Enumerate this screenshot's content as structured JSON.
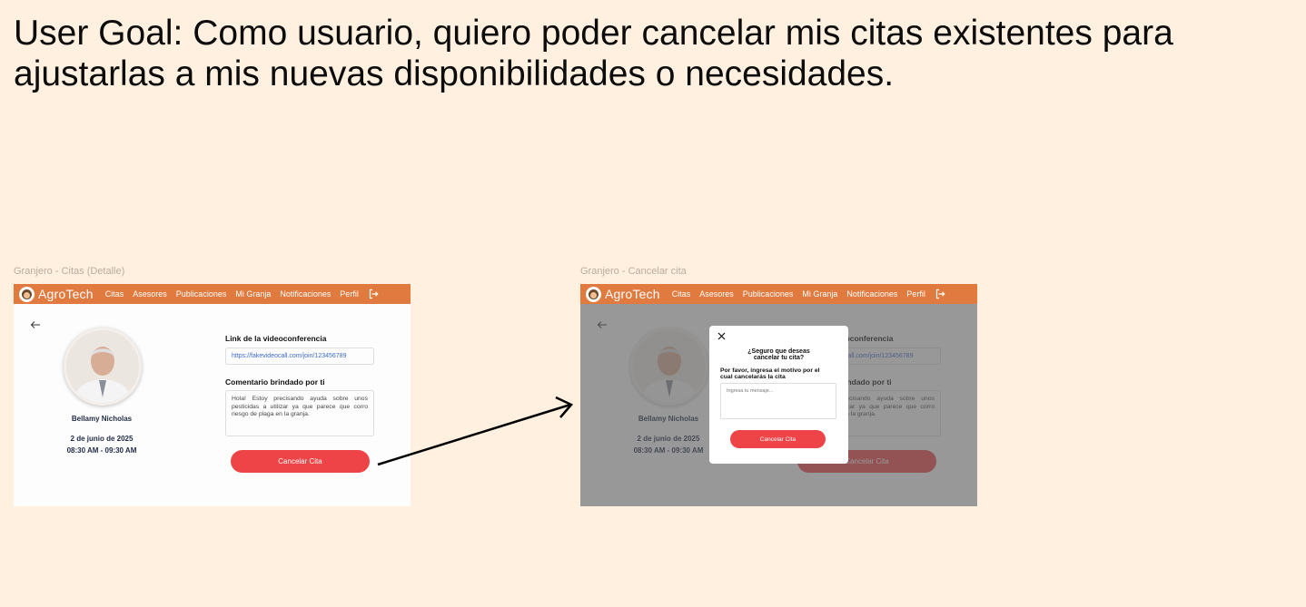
{
  "user_goal": "User Goal: Como usuario, quiero poder cancelar mis citas existentes para ajustarlas a mis nuevas disponibilidades o necesidades.",
  "frames": {
    "detail_label": "Granjero - Citas (Detalle)",
    "cancel_label": "Granjero - Cancelar cita"
  },
  "navbar": {
    "brand": "AgroTech",
    "items": [
      "Citas",
      "Asesores",
      "Publicaciones",
      "Mi Granja",
      "Notificaciones",
      "Perfil"
    ],
    "logout_icon": "logout-icon",
    "color": "#E07A3E"
  },
  "appointment": {
    "advisor_name": "Bellamy Nicholas",
    "date": "2 de junio de 2025",
    "time": "08:30 AM - 09:30 AM",
    "link_title": "Link de la videoconferencia",
    "link_url": "https://fakevideocall.com/join/123456789",
    "comment_title": "Comentario brindado por ti",
    "comment": "Hola! Estoy precisando ayuda sobre unos pesticidas a utilizar ya que parece que corro riesgo de plaga en la granja.",
    "cancel_button": "Cancelar Cita",
    "accent": "#EE4447"
  },
  "modal": {
    "title_line1": "¿Seguro que deseas",
    "title_line2": "cancelar tu cita?",
    "subtitle_line1": "Por favor, ingresa el motivo por el",
    "subtitle_line2": "cual cancelarás la cita",
    "input_placeholder": "Ingresa tu mensaje...",
    "confirm_button": "Cancelar Cita"
  }
}
